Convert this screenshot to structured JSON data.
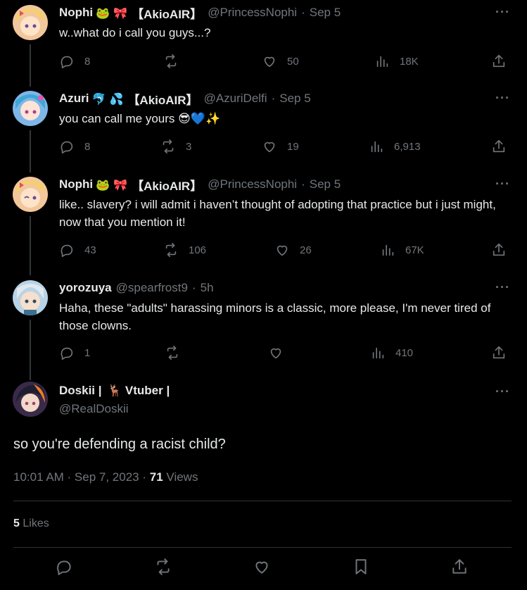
{
  "tweets": [
    {
      "name": "Nophi",
      "emojis": "🐸 🎀",
      "tag": "【AkioAIR】",
      "handle": "@PrincessNophi",
      "time": "Sep 5",
      "text": "w..what do i call you guys...?",
      "replies": "8",
      "retweets": "",
      "likes": "50",
      "views": "18K",
      "avatar_color": "#f2c79b"
    },
    {
      "name": "Azuri",
      "emojis": "🐬 💦",
      "tag": "【AkioAIR】",
      "handle": "@AzuriDelfi",
      "time": "Sep 5",
      "text": "you can call me yours 😎💙✨",
      "replies": "8",
      "retweets": "3",
      "likes": "19",
      "views": "6,913",
      "avatar_color": "#7fb6e8"
    },
    {
      "name": "Nophi",
      "emojis": "🐸 🎀",
      "tag": "【AkioAIR】",
      "handle": "@PrincessNophi",
      "time": "Sep 5",
      "text": "like.. slavery? i will admit i haven’t thought of adopting that practice but i just might, now that you mention it!",
      "replies": "43",
      "retweets": "106",
      "likes": "26",
      "views": "67K",
      "avatar_color": "#f2c79b"
    },
    {
      "name": "yorozuya",
      "emojis": "",
      "tag": "",
      "handle": "@spearfrost9",
      "time": "5h",
      "text": "Haha, these \"adults\" harassing minors is a classic, more please, I'm never tired of those clowns.",
      "replies": "1",
      "retweets": "",
      "likes": "",
      "views": "410",
      "avatar_color": "#b9d3e6"
    }
  ],
  "main": {
    "name": "Doskii |",
    "emoji": "🦌",
    "name_suffix": "Vtuber |",
    "handle": "@RealDoskii",
    "text": "so you're defending a racist child?",
    "time": "10:01 AM · Sep 7, 2023 ·",
    "views_count": "71",
    "views_label": "Views",
    "likes_count": "5",
    "likes_label": "Likes",
    "avatar_color": "#3a2a4a"
  },
  "more_label": "···"
}
